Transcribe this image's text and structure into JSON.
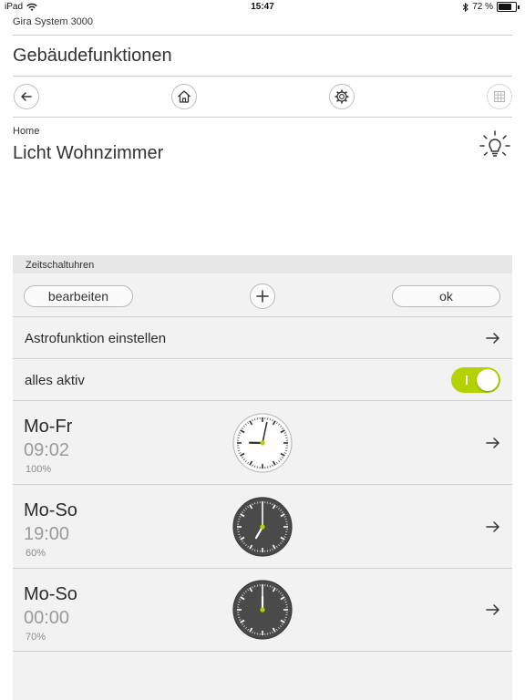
{
  "status_bar": {
    "device": "iPad",
    "time": "15:47",
    "battery_text": "72 %"
  },
  "app": {
    "title": "Gira System 3000"
  },
  "page": {
    "title": "Gebäudefunktionen"
  },
  "device": {
    "breadcrumb": "Home",
    "name": "Licht Wohnzimmer"
  },
  "timers": {
    "section_title": "Zeitschaltuhren",
    "edit_label": "bearbeiten",
    "ok_label": "ok",
    "astro_label": "Astrofunktion einstellen",
    "all_active_label": "alles aktiv",
    "all_active_on": true,
    "items": [
      {
        "days": "Mo-Fr",
        "time": "09:02",
        "percent": "100%",
        "clock_style": "light"
      },
      {
        "days": "Mo-So",
        "time": "19:00",
        "percent": "60%",
        "clock_style": "dark"
      },
      {
        "days": "Mo-So",
        "time": "00:00",
        "percent": "70%",
        "clock_style": "dark"
      }
    ]
  },
  "colors": {
    "accent": "#b4d200",
    "clock_dark": "#4a4a4a",
    "panel": "#f2f2f2",
    "divider": "#cfcfcf"
  }
}
